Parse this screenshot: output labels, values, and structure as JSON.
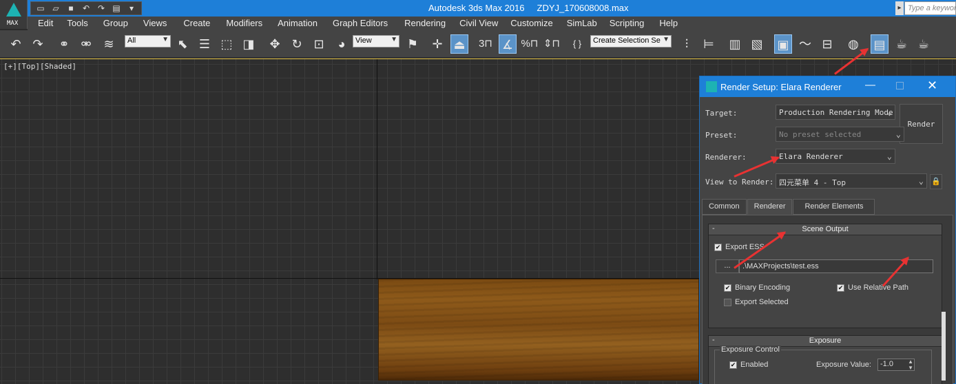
{
  "app": {
    "title": "Autodesk 3ds Max 2016",
    "file": "ZDYJ_170608008.max",
    "logo_label": "MAX",
    "search_placeholder": "Type a keyword"
  },
  "menu": [
    "Edit",
    "Tools",
    "Group",
    "Views",
    "Create",
    "Modifiers",
    "Animation",
    "Graph Editors",
    "Rendering",
    "Civil View",
    "Customize",
    "SimLab",
    "Scripting",
    "Help"
  ],
  "toolbar": {
    "filter": "All",
    "coord": "View",
    "selection_set": "Create Selection Se"
  },
  "viewport": {
    "label": "[+][Top][Shaded]"
  },
  "render_setup": {
    "title": "Render Setup: Elara Renderer",
    "target_label": "Target:",
    "target_value": "Production Rendering Mode",
    "preset_label": "Preset:",
    "preset_value": "No preset selected",
    "renderer_label": "Renderer:",
    "renderer_value": "Elara Renderer",
    "view_label": "View to Render:",
    "view_value": "四元菜单 4 - Top",
    "render_button": "Render",
    "tabs": [
      "Common",
      "Renderer",
      "Render Elements"
    ],
    "active_tab": 1,
    "scene_output": {
      "title": "Scene Output",
      "export_ess": "Export ESS",
      "browse": "...",
      "path": ".\\MAXProjects\\test.ess",
      "binary_encoding": "Binary Encoding",
      "use_relative_path": "Use Relative Path",
      "export_selected": "Export Selected"
    },
    "exposure": {
      "title": "Exposure",
      "group": "Exposure Control",
      "enabled": "Enabled",
      "value_label": "Exposure Value:",
      "value": "-1.0"
    }
  }
}
